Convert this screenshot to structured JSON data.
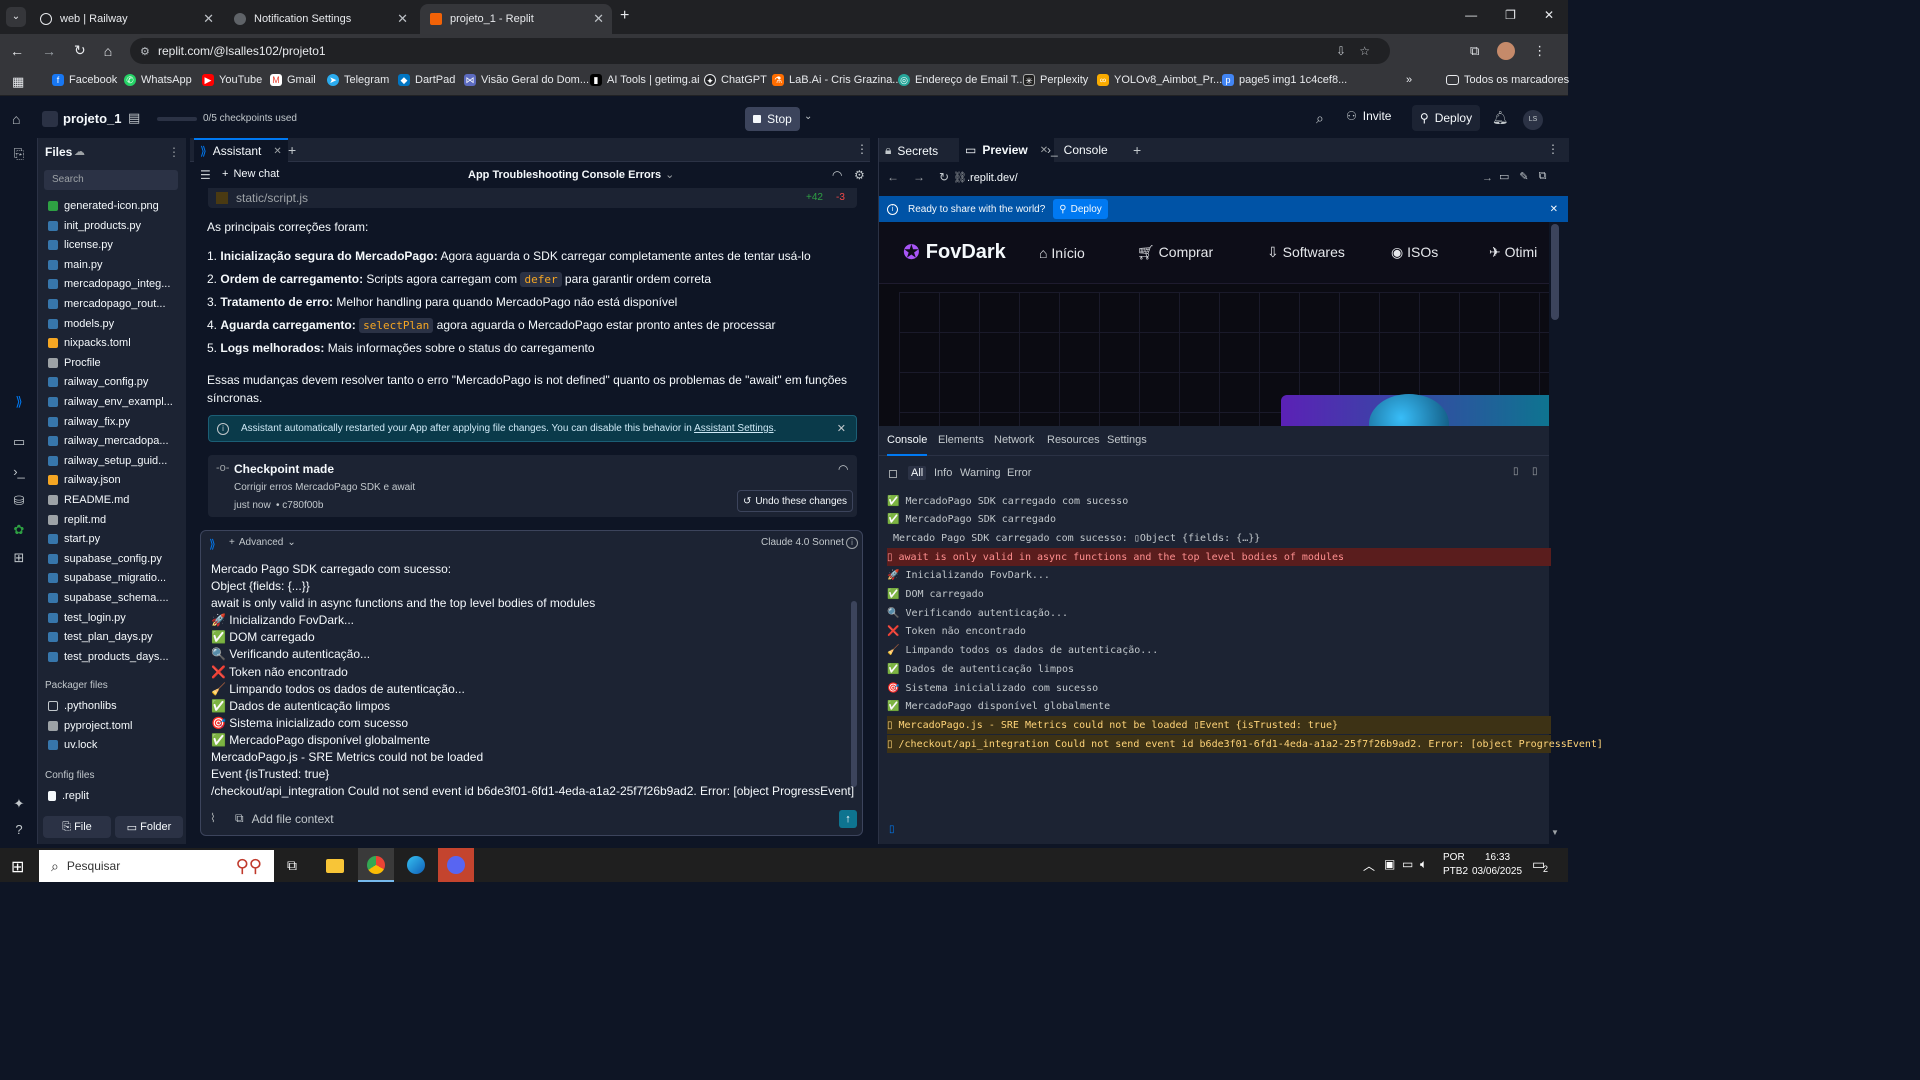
{
  "browser": {
    "tabs": [
      {
        "title": "web | Railway"
      },
      {
        "title": "Notification Settings"
      },
      {
        "title": "projeto_1 - Replit"
      }
    ],
    "url": "replit.com/@lsalles102/projeto1",
    "bookmarks": [
      "Facebook",
      "WhatsApp",
      "YouTube",
      "Gmail",
      "Telegram",
      "DartPad",
      "Visão Geral do Dom...",
      "AI Tools | getimg.ai",
      "ChatGPT",
      "LaB.Ai - Cris Grazina...",
      "Endereço de Email T...",
      "Perplexity",
      "YOLOv8_Aimbot_Pr...",
      "page5 img1 1c4cef8...",
      "Todos os marcadores"
    ]
  },
  "replit": {
    "project": "projeto_1",
    "checkpoints": "0/5 checkpoints used",
    "stop": "Stop",
    "invite": "Invite",
    "deploy": "Deploy",
    "avatar": "LS"
  },
  "files": {
    "title": "Files",
    "search_placeholder": "Search",
    "items": [
      "generated-icon.png",
      "init_products.py",
      "license.py",
      "main.py",
      "mercadopago_integ...",
      "mercadopago_rout...",
      "models.py",
      "nixpacks.toml",
      "Procfile",
      "railway_config.py",
      "railway_env_exampl...",
      "railway_fix.py",
      "railway_mercadopa...",
      "railway_setup_guid...",
      "railway.json",
      "README.md",
      "replit.md",
      "start.py",
      "supabase_config.py",
      "supabase_migratio...",
      "supabase_schema....",
      "test_login.py",
      "test_plan_days.py",
      "test_products_days..."
    ],
    "packager_title": "Packager files",
    "packager": [
      ".pythonlibs",
      "pyproject.toml",
      "uv.lock"
    ],
    "config_title": "Config files",
    "config": [
      ".replit"
    ],
    "file_btn": "File",
    "folder_btn": "Folder"
  },
  "assistant": {
    "tab": "Assistant",
    "new_chat": "New chat",
    "chat_title": "App Troubleshooting Console Errors",
    "file_changed": "static/script.js",
    "added": "+42",
    "removed": "-3",
    "intro": "As principais correções foram:",
    "fixes": [
      {
        "n": "1.",
        "b": "Inicialização segura do MercadoPago:",
        "t": " Agora aguarda o SDK carregar completamente antes de tentar usá-lo"
      },
      {
        "n": "2.",
        "b": "Ordem de carregamento:",
        "t": " Scripts agora carregam com ",
        "code": "defer",
        "t2": " para garantir ordem correta"
      },
      {
        "n": "3.",
        "b": "Tratamento de erro:",
        "t": " Melhor handling para quando MercadoPago não está disponível"
      },
      {
        "n": "4.",
        "b": "Aguarda carregamento:",
        "t": " ",
        "code": "selectPlan",
        "t2": " agora aguarda o MercadoPago estar pronto antes de processar"
      },
      {
        "n": "5.",
        "b": "Logs melhorados:",
        "t": " Mais informações sobre o status do carregamento"
      }
    ],
    "summary": "Essas mudanças devem resolver tanto o erro \"MercadoPago is not defined\" quanto os problemas de \"await\" em funções síncronas.",
    "notice": "Assistant automatically restarted your App after applying file changes. You can disable this behavior in ",
    "notice_link": "Assistant Settings",
    "checkpoint_title": "Checkpoint made",
    "checkpoint_desc": "Corrigir erros MercadoPago SDK e await",
    "checkpoint_time": "just now",
    "checkpoint_hash": "• c780f00b",
    "undo": "Undo these changes",
    "advanced": "Advanced",
    "model": "Claude 4.0 Sonnet",
    "input_lines": [
      "Mercado Pago SDK carregado com sucesso:",
      "Object {fields: {...}}",
      "await is only valid in async functions and the top level bodies of modules",
      "🚀 Inicializando FovDark...",
      "✅ DOM carregado",
      "🔍 Verificando autenticação...",
      "❌ Token não encontrado",
      "🧹 Limpando todos os dados de autenticação...",
      "✅ Dados de autenticação limpos",
      "🎯 Sistema inicializado com sucesso",
      "✅ MercadoPago disponível globalmente",
      "MercadoPago.js - SRE Metrics could not be loaded",
      "Event {isTrusted: true}",
      "/checkout/api_integration Could not send event id b6de3f01-6fd1-4eda-a1a2-25f7f26b9ad2. Error: [object ProgressEvent]"
    ],
    "add_context": "Add file context"
  },
  "right": {
    "tabs": [
      "Secrets",
      "Preview",
      "Console"
    ],
    "preview_url": ".replit.dev/",
    "share": "Ready to share with the world?",
    "share_deploy": "Deploy",
    "site_logo": "FovDark",
    "site_nav": [
      "Início",
      "Comprar",
      "Softwares",
      "ISOs",
      "Otimi"
    ],
    "devtools_tabs": [
      "Console",
      "Elements",
      "Network",
      "Resources",
      "Settings"
    ],
    "filters": [
      "All",
      "Info",
      "Warning",
      "Error"
    ],
    "console": [
      {
        "icon": "✅",
        "text": "MercadoPago SDK carregado com sucesso",
        "type": "log"
      },
      {
        "icon": "✅",
        "text": "MercadoPago SDK carregado",
        "type": "log"
      },
      {
        "icon": "",
        "text": "Mercado Pago SDK carregado com sucesso: ▯Object {fields: {…}}",
        "type": "log"
      },
      {
        "icon": "▯",
        "text": "await is only valid in async functions and the top level bodies of modules",
        "type": "error"
      },
      {
        "icon": "🚀",
        "text": "Inicializando FovDark...",
        "type": "log"
      },
      {
        "icon": "✅",
        "text": "DOM carregado",
        "type": "log"
      },
      {
        "icon": "🔍",
        "text": "Verificando autenticação...",
        "type": "log"
      },
      {
        "icon": "❌",
        "text": "Token não encontrado",
        "type": "log"
      },
      {
        "icon": "🧹",
        "text": "Limpando todos os dados de autenticação...",
        "type": "log"
      },
      {
        "icon": "✅",
        "text": "Dados de autenticação limpos",
        "type": "log"
      },
      {
        "icon": "🎯",
        "text": "Sistema inicializado com sucesso",
        "type": "log"
      },
      {
        "icon": "✅",
        "text": "MercadoPago disponível globalmente",
        "type": "log"
      },
      {
        "icon": "▯",
        "text": "MercadoPago.js - SRE Metrics could not be loaded ▯Event {isTrusted: true}",
        "type": "warn"
      },
      {
        "icon": "▯",
        "text": "/checkout/api_integration Could not send event id b6de3f01-6fd1-4eda-a1a2-25f7f26b9ad2. Error: [object ProgressEvent]",
        "type": "warn"
      }
    ]
  },
  "taskbar": {
    "search": "Pesquisar",
    "lang1": "POR",
    "lang2": "PTB2",
    "time": "16:33",
    "date": "03/06/2025",
    "notif": "2"
  },
  "colors": {
    "accent": "#0079f2",
    "error_bg": "#5a1d1d",
    "warn_bg": "#3d3215",
    "site_purple": "#a855f7"
  }
}
